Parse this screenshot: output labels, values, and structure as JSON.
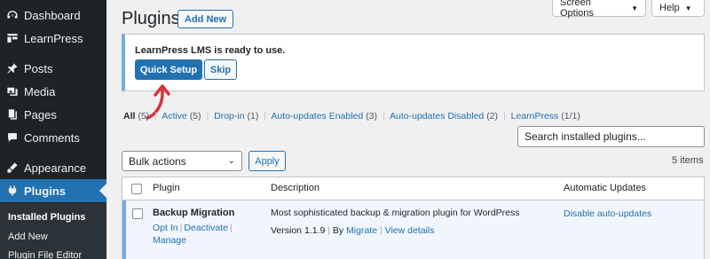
{
  "sidebar": {
    "items": [
      {
        "label": "Dashboard",
        "icon": "dashboard-icon"
      },
      {
        "label": "LearnPress",
        "icon": "learnpress-icon"
      },
      {
        "label": "Posts",
        "icon": "pin-icon"
      },
      {
        "label": "Media",
        "icon": "media-icon"
      },
      {
        "label": "Pages",
        "icon": "pages-icon"
      },
      {
        "label": "Comments",
        "icon": "comments-icon"
      },
      {
        "label": "Appearance",
        "icon": "appearance-icon"
      },
      {
        "label": "Plugins",
        "icon": "plugins-icon"
      }
    ],
    "submenu": [
      "Installed Plugins",
      "Add New",
      "Plugin File Editor"
    ]
  },
  "header": {
    "title": "Plugins",
    "add_new": "Add New",
    "screen_options": "Screen Options",
    "help": "Help"
  },
  "notice": {
    "text": "LearnPress LMS is ready to use.",
    "quick_setup": "Quick Setup",
    "skip": "Skip"
  },
  "filters": {
    "all": "All",
    "all_count": "(5)",
    "active": "Active",
    "active_count": "(5)",
    "dropin": "Drop-in",
    "dropin_count": "(1)",
    "auto_enabled": "Auto-updates Enabled",
    "auto_enabled_count": "(3)",
    "auto_disabled": "Auto-updates Disabled",
    "auto_disabled_count": "(2)",
    "learnpress": "LearnPress",
    "learnpress_count": "(1/1)"
  },
  "search": {
    "placeholder": "Search installed plugins..."
  },
  "bulk": {
    "selected": "Bulk actions",
    "apply": "Apply",
    "items_count": "5 items"
  },
  "table": {
    "headers": {
      "plugin": "Plugin",
      "description": "Description",
      "auto_updates": "Automatic Updates"
    },
    "rows": [
      {
        "name": "Backup Migration",
        "actions": {
          "opt_in": "Opt In",
          "deactivate": "Deactivate",
          "manage": "Manage"
        },
        "description": "Most sophisticated backup & migration plugin for WordPress",
        "version": "Version 1.1.9",
        "by": "By",
        "author": "Migrate",
        "view_details": "View details",
        "auto_update": "Disable auto-updates"
      }
    ]
  },
  "colors": {
    "accent": "#2271b1",
    "sidebar": "#1d2327",
    "arrow": "#d63638"
  }
}
